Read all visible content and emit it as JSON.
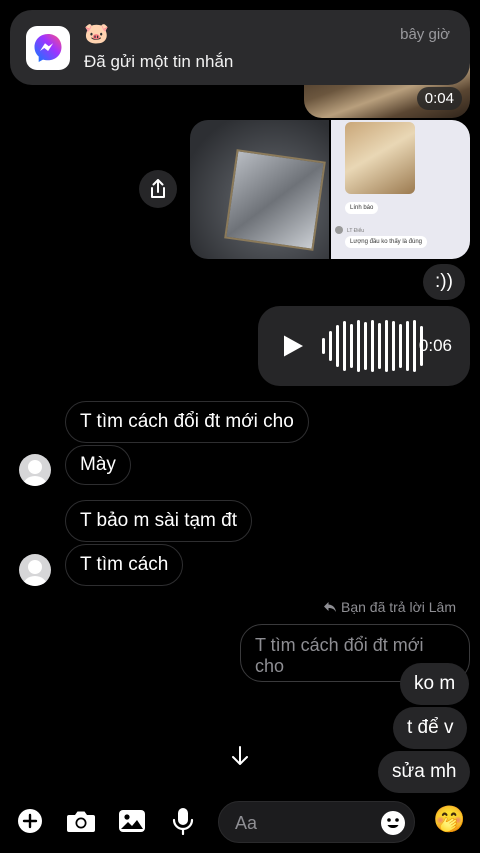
{
  "notification": {
    "app_icon": "messenger-icon",
    "sender_emoji": "🐷",
    "message": "Đã gửi một tin nhắn",
    "time": "bây giờ"
  },
  "video": {
    "duration": "0:04"
  },
  "photo_screenshot": {
    "bubble1": "Lính báo",
    "bubble2_name": "LT Điểu",
    "bubble2_text": "Lượng đầu ko thấy là đúng"
  },
  "messages": {
    "smiley": ":))",
    "voice_duration": "0:06",
    "in1": "T tìm cách đổi đt mới cho",
    "in2": "Mày",
    "in3": "T bảo m sài tạm đt",
    "in4": "T tìm cách",
    "reply_label": "Bạn đã trả lời Lâm",
    "quoted": "T tìm cách đổi đt mới cho",
    "out1": "ko m",
    "out2": "t để v",
    "out3": "sửa mh"
  },
  "composer": {
    "placeholder": "Aa",
    "reaction_emoji": "🤭"
  },
  "colors": {
    "background": "#000000",
    "bubble_out": "#262628",
    "messenger_gradient_start": "#0a7cff",
    "messenger_gradient_end": "#a033ff"
  }
}
